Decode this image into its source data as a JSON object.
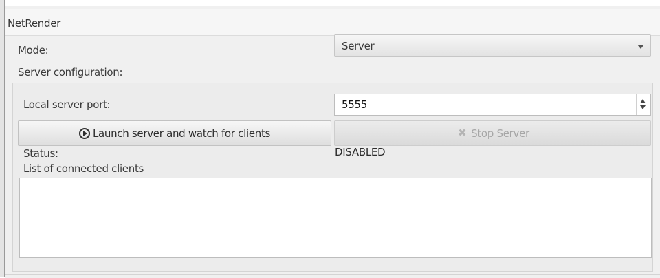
{
  "panel": {
    "title": "NetRender"
  },
  "mode": {
    "label": "Mode:",
    "selected": "Server"
  },
  "server_config": {
    "label": "Server configuration:",
    "port_label": "Local server port:",
    "port_value": "5555",
    "launch_button": {
      "prefix": "Launch server and ",
      "mnemonic": "w",
      "suffix": "atch for clients",
      "icon": "play-circle-icon"
    },
    "stop_button": {
      "label": "Stop Server",
      "icon": "stop-x-icon",
      "enabled": false
    },
    "status_label": "Status:",
    "status_value": "DISABLED",
    "clients_label": "List of connected clients",
    "clients": []
  }
}
